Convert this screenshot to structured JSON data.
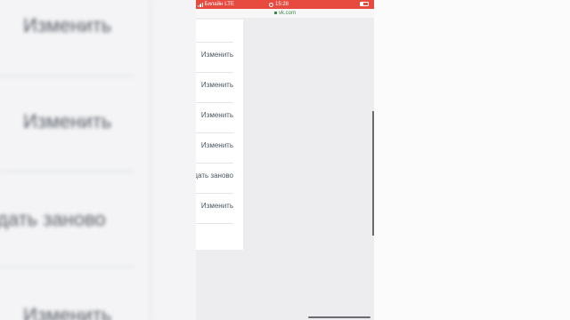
{
  "status_bar": {
    "carrier": "Билайн",
    "network": "LTE",
    "time": "15:28"
  },
  "browser": {
    "url": "vk.com"
  },
  "menu_rows": [
    {
      "label": "Изменить"
    },
    {
      "label": "Изменить"
    },
    {
      "label": "Изменить"
    },
    {
      "label": "Изменить"
    },
    {
      "label": "дать заново"
    },
    {
      "label": "Изменить"
    }
  ],
  "background_blur": {
    "left_labels": [
      "Изменить",
      "Изменить",
      "дать заново",
      "Изменить"
    ]
  },
  "colors": {
    "status_bar": "#e74b3f",
    "link_text": "#4a5562",
    "url_text": "#3d8a4a"
  }
}
